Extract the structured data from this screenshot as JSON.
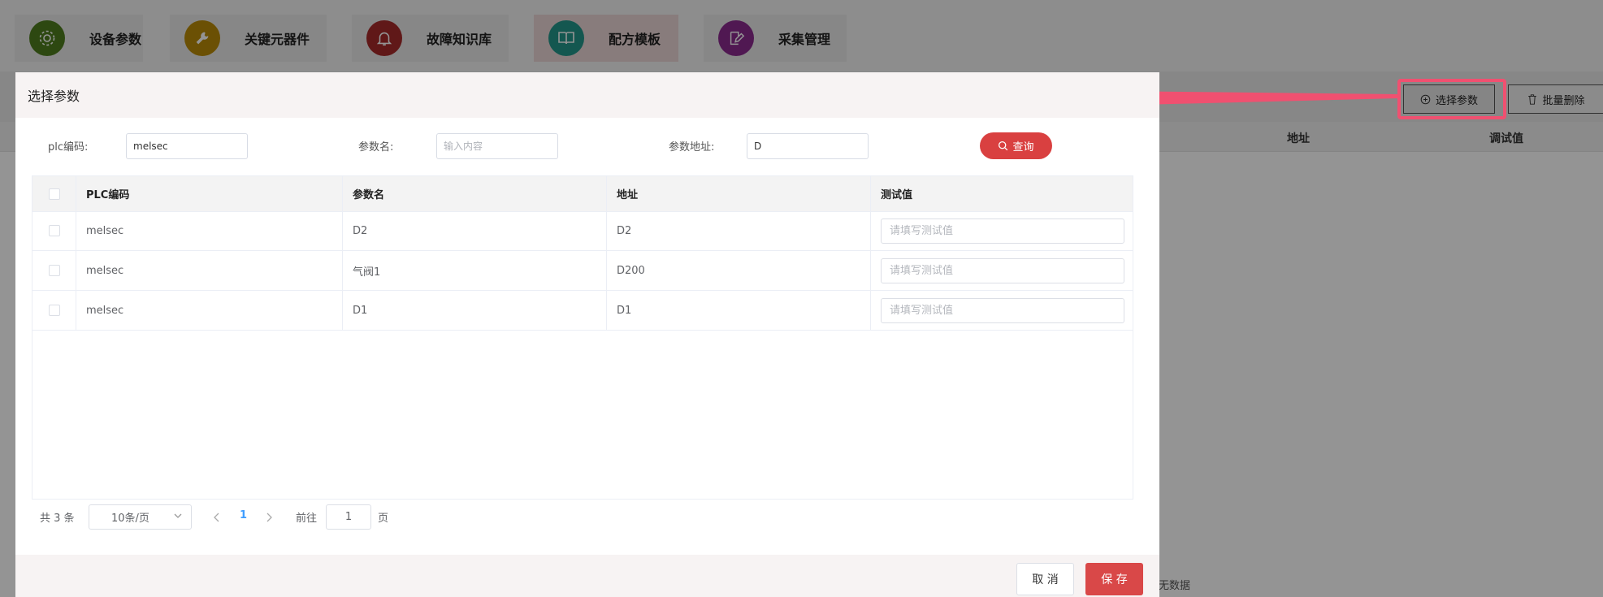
{
  "nav": [
    {
      "label": "设备参数",
      "icon": "gear-icon",
      "color": "#4e7d1e"
    },
    {
      "label": "关键元器件",
      "icon": "wrench-icon",
      "color": "#b98b08"
    },
    {
      "label": "故障知识库",
      "icon": "bell-icon",
      "color": "#a52a2a"
    },
    {
      "label": "配方模板",
      "icon": "book-icon",
      "color": "#23968a"
    },
    {
      "label": "采集管理",
      "icon": "edit-icon",
      "color": "#8a2a8e"
    }
  ],
  "background": {
    "select_param_button": "选择参数",
    "batch_delete_button": "批量删除",
    "col_address": "地址",
    "col_debug_value": "调试值",
    "no_data": "无数据"
  },
  "modal": {
    "title": "选择参数",
    "filters": {
      "plc_code_label": "plc编码:",
      "plc_code_value": "melsec",
      "param_name_label": "参数名:",
      "param_name_placeholder": "输入内容",
      "param_addr_label": "参数地址:",
      "param_addr_value": "D",
      "query_button": "查询"
    },
    "table": {
      "headers": [
        "PLC编码",
        "参数名",
        "地址",
        "测试值"
      ],
      "test_value_placeholder": "请填写测试值",
      "rows": [
        {
          "plc": "melsec",
          "name": "D2",
          "address": "D2"
        },
        {
          "plc": "melsec",
          "name": "气阀1",
          "address": "D200"
        },
        {
          "plc": "melsec",
          "name": "D1",
          "address": "D1"
        }
      ]
    },
    "pagination": {
      "total": "共 3 条",
      "page_size": "10条/页",
      "current_page": "1",
      "goto_label": "前往",
      "goto_value": "1",
      "page_suffix": "页"
    },
    "cancel_button": "取 消",
    "save_button": "保 存"
  },
  "colors": {
    "accent_red": "#d94040",
    "annotation": "#f05070"
  }
}
